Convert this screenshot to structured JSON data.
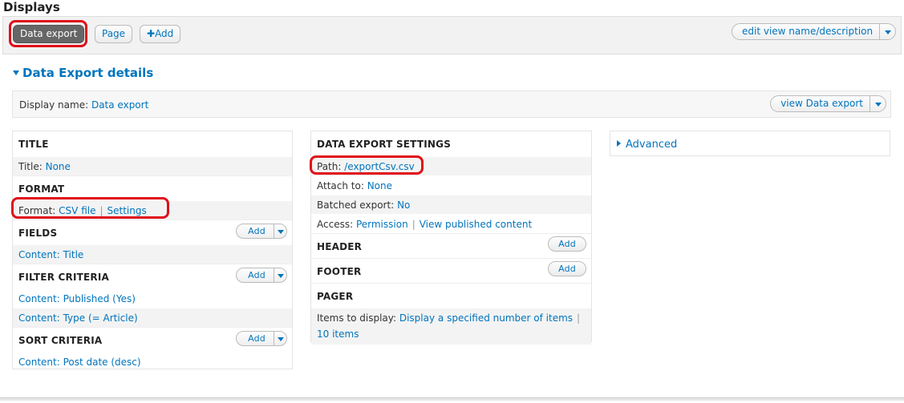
{
  "header": {
    "title": "Displays"
  },
  "topbar": {
    "tabs": [
      {
        "label": "Data export",
        "active": true
      },
      {
        "label": "Page",
        "active": false
      }
    ],
    "add_label": "Add",
    "edit_label": "edit view name/description"
  },
  "details": {
    "title": "Data Export details",
    "display_name_label": "Display name:",
    "display_name_value": "Data export",
    "view_label": "view Data export"
  },
  "left": {
    "title": {
      "heading": "TITLE",
      "label": "Title:",
      "value": "None"
    },
    "format": {
      "heading": "FORMAT",
      "label": "Format:",
      "value": "CSV file",
      "settings": "Settings"
    },
    "fields": {
      "heading": "FIELDS",
      "add": "Add",
      "items": [
        "Content: Title"
      ]
    },
    "filters": {
      "heading": "FILTER CRITERIA",
      "add": "Add",
      "items": [
        "Content: Published (Yes)",
        "Content: Type (= Article)"
      ]
    },
    "sort": {
      "heading": "SORT CRITERIA",
      "add": "Add",
      "items": [
        "Content: Post date (desc)"
      ]
    }
  },
  "middle": {
    "settings_heading": "DATA EXPORT SETTINGS",
    "path_label": "Path:",
    "path_value": "/exportCsv.csv",
    "attach_label": "Attach to:",
    "attach_value": "None",
    "batched_label": "Batched export:",
    "batched_value": "No",
    "access_label": "Access:",
    "access_value": "Permission",
    "access_extra": "View published content",
    "header_heading": "HEADER",
    "header_add": "Add",
    "footer_heading": "FOOTER",
    "footer_add": "Add",
    "pager_heading": "PAGER",
    "pager_label": "Items to display:",
    "pager_value": "Display a specified number of items",
    "pager_items": "10 items"
  },
  "right": {
    "advanced": "Advanced"
  },
  "colors": {
    "link": "#0074bd",
    "highlight": "#e01018",
    "active_tab": "#666666"
  }
}
